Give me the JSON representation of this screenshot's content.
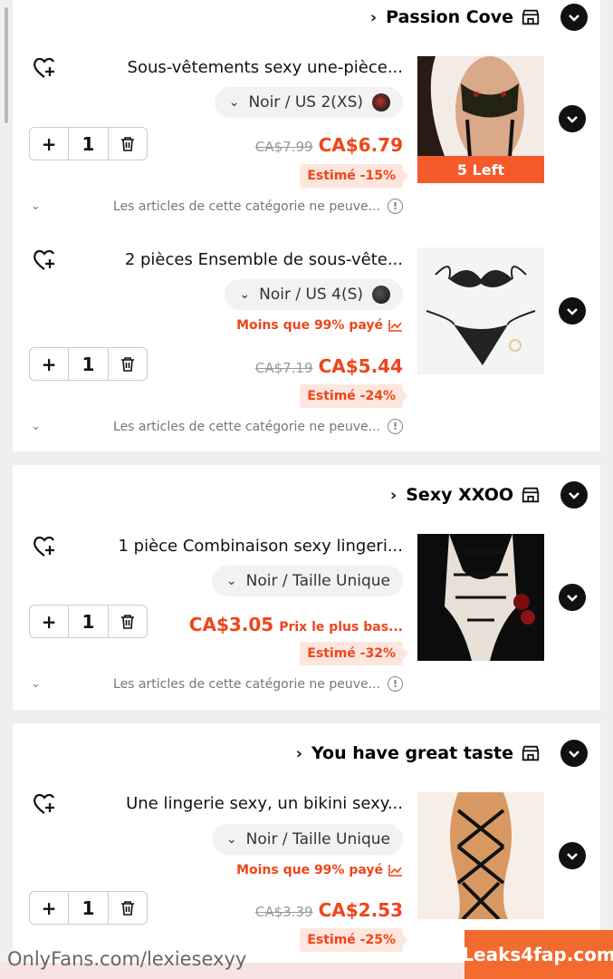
{
  "sections": [
    {
      "shop_name": "Passion Cove",
      "items": [
        {
          "title": "Sous-vêtements sexy une-pièce...",
          "variant": "Noir / US 2(XS)",
          "quantity": "1",
          "price": "CA$6.79",
          "old_price": "CA$7.99",
          "estimate": "Estimé -15%",
          "stock_badge": "5 Left",
          "notice": "Les articles de cette catégorie ne peuve..."
        },
        {
          "title": "2 pièces Ensemble de sous-vête...",
          "variant": "Noir / US 4(S)",
          "paid_note": "Moins que 99% payé",
          "quantity": "1",
          "price": "CA$5.44",
          "old_price": "CA$7.19",
          "estimate": "Estimé -24%",
          "notice": "Les articles de cette catégorie ne peuve..."
        }
      ]
    },
    {
      "shop_name": "Sexy XXOO",
      "items": [
        {
          "title": "1 pièce Combinaison sexy lingeri...",
          "variant": "Noir / Taille Unique",
          "quantity": "1",
          "price": "CA$3.05",
          "price_note": "Prix le plus bas...",
          "estimate": "Estimé -32%",
          "notice": "Les articles de cette catégorie ne peuve..."
        }
      ]
    },
    {
      "shop_name": "You have great taste",
      "items": [
        {
          "title": "Une lingerie sexy, un bikini sexy...",
          "variant": "Noir / Taille Unique",
          "paid_note": "Moins que 99% payé",
          "quantity": "1",
          "price": "CA$2.53",
          "old_price": "CA$3.39",
          "estimate": "Estimé -25%"
        }
      ]
    }
  ],
  "watermark": "OnlyFans.com/lexiesexyy",
  "logo_text": "Leaks4fap.com",
  "colors": {
    "accent": "#f0451a",
    "badge_bg": "#fde6dd",
    "stock_badge": "#f45a2a"
  },
  "icons": {
    "wishlist": "heart-plus-icon",
    "delete": "trash-icon",
    "store": "store-icon",
    "expand": "chevron-down-icon",
    "info": "info-icon"
  }
}
